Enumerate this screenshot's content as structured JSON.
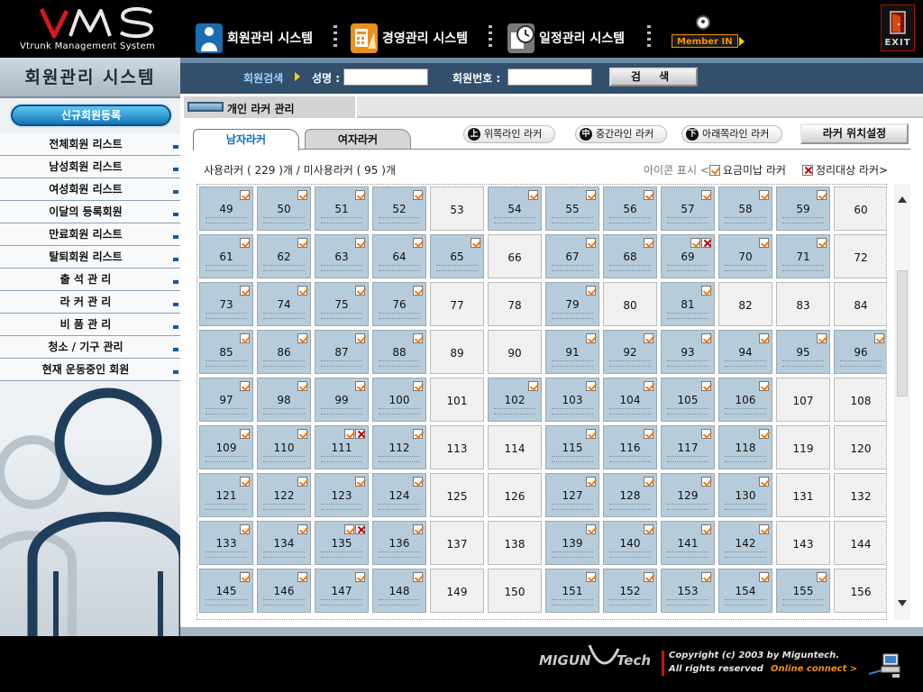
{
  "header": {
    "logo": "VMS",
    "logo_subtitle": "Vtrunk Management System",
    "nav": [
      {
        "label": "회원관리 시스템",
        "icon": "member-person-icon"
      },
      {
        "label": "경영관리 시스템",
        "icon": "calculator-chart-icon"
      },
      {
        "label": "일정관리 시스템",
        "icon": "clock-calendar-icon"
      }
    ],
    "member_in": "Member IN",
    "exit": "EXIT"
  },
  "sidebar": {
    "title": "회원관리 시스템",
    "new_member_button": "신규회원등록",
    "menu": [
      "전체회원 리스트",
      "남성회원 리스트",
      "여성회원 리스트",
      "이달의 등록회원",
      "만료회원 리스트",
      "탈퇴회원 리스트",
      "출 석 관 리",
      "라 커 관 리",
      "비 품 관 리",
      "청소 / 기구 관리",
      "현재 운동중인 회원"
    ]
  },
  "search": {
    "label": "회원검색",
    "name_label": "성명 :",
    "name_value": "",
    "member_no_label": "회원번호 :",
    "member_no_value": "",
    "button": "검 색"
  },
  "section": {
    "title": "개인 라커 관리"
  },
  "tabs": [
    "남자라커",
    "여자라커"
  ],
  "active_tab": 0,
  "line_buttons": [
    {
      "label": "위쪽라인 라커",
      "glyph": "上"
    },
    {
      "label": "중간라인 라커",
      "glyph": "中"
    },
    {
      "label": "아래쪽라인 라커",
      "glyph": "下"
    }
  ],
  "locker_position_button": "라커 위치설정",
  "usage": {
    "prefix": "사용라커 (",
    "used": "229",
    "middle": ")개 / 미사용라커 (",
    "unused": "95",
    "suffix": ")개"
  },
  "legend": {
    "caption": "아이콘 표시 <",
    "unpaid": "요금미납 라커",
    "cleanup": "정리대상 라커>"
  },
  "lockers": [
    {
      "n": "49",
      "s": "c"
    },
    {
      "n": "50",
      "s": "c"
    },
    {
      "n": "51",
      "s": "c"
    },
    {
      "n": "52",
      "s": "c"
    },
    {
      "n": "53",
      "s": "e"
    },
    {
      "n": "54",
      "s": "c"
    },
    {
      "n": "55",
      "s": "c"
    },
    {
      "n": "56",
      "s": "c"
    },
    {
      "n": "57",
      "s": "c"
    },
    {
      "n": "58",
      "s": "c"
    },
    {
      "n": "59",
      "s": "c"
    },
    {
      "n": "60",
      "s": "e"
    },
    {
      "n": "61",
      "s": "c"
    },
    {
      "n": "62",
      "s": "c"
    },
    {
      "n": "63",
      "s": "c"
    },
    {
      "n": "64",
      "s": "c"
    },
    {
      "n": "65",
      "s": "c"
    },
    {
      "n": "66",
      "s": "e"
    },
    {
      "n": "67",
      "s": "c"
    },
    {
      "n": "68",
      "s": "c"
    },
    {
      "n": "69",
      "s": "cx"
    },
    {
      "n": "70",
      "s": "c"
    },
    {
      "n": "71",
      "s": "c"
    },
    {
      "n": "72",
      "s": "e"
    },
    {
      "n": "73",
      "s": "c"
    },
    {
      "n": "74",
      "s": "c"
    },
    {
      "n": "75",
      "s": "c"
    },
    {
      "n": "76",
      "s": "c"
    },
    {
      "n": "77",
      "s": "e"
    },
    {
      "n": "78",
      "s": "e"
    },
    {
      "n": "79",
      "s": "c"
    },
    {
      "n": "80",
      "s": "e"
    },
    {
      "n": "81",
      "s": "c"
    },
    {
      "n": "82",
      "s": "e"
    },
    {
      "n": "83",
      "s": "e"
    },
    {
      "n": "84",
      "s": "e"
    },
    {
      "n": "85",
      "s": "c"
    },
    {
      "n": "86",
      "s": "c"
    },
    {
      "n": "87",
      "s": "c"
    },
    {
      "n": "88",
      "s": "c"
    },
    {
      "n": "89",
      "s": "e"
    },
    {
      "n": "90",
      "s": "e"
    },
    {
      "n": "91",
      "s": "c"
    },
    {
      "n": "92",
      "s": "c"
    },
    {
      "n": "93",
      "s": "c"
    },
    {
      "n": "94",
      "s": "c"
    },
    {
      "n": "95",
      "s": "c"
    },
    {
      "n": "96",
      "s": "c"
    },
    {
      "n": "97",
      "s": "c"
    },
    {
      "n": "98",
      "s": "c"
    },
    {
      "n": "99",
      "s": "c"
    },
    {
      "n": "100",
      "s": "c"
    },
    {
      "n": "101",
      "s": "e"
    },
    {
      "n": "102",
      "s": "c"
    },
    {
      "n": "103",
      "s": "c"
    },
    {
      "n": "104",
      "s": "c"
    },
    {
      "n": "105",
      "s": "c"
    },
    {
      "n": "106",
      "s": "c"
    },
    {
      "n": "107",
      "s": "e"
    },
    {
      "n": "108",
      "s": "e"
    },
    {
      "n": "109",
      "s": "c"
    },
    {
      "n": "110",
      "s": "c"
    },
    {
      "n": "111",
      "s": "cx"
    },
    {
      "n": "112",
      "s": "c"
    },
    {
      "n": "113",
      "s": "e"
    },
    {
      "n": "114",
      "s": "e"
    },
    {
      "n": "115",
      "s": "c"
    },
    {
      "n": "116",
      "s": "c"
    },
    {
      "n": "117",
      "s": "c"
    },
    {
      "n": "118",
      "s": "c"
    },
    {
      "n": "119",
      "s": "e"
    },
    {
      "n": "120",
      "s": "e"
    },
    {
      "n": "121",
      "s": "c"
    },
    {
      "n": "122",
      "s": "c"
    },
    {
      "n": "123",
      "s": "c"
    },
    {
      "n": "124",
      "s": "c"
    },
    {
      "n": "125",
      "s": "e"
    },
    {
      "n": "126",
      "s": "e"
    },
    {
      "n": "127",
      "s": "c"
    },
    {
      "n": "128",
      "s": "c"
    },
    {
      "n": "129",
      "s": "c"
    },
    {
      "n": "130",
      "s": "c"
    },
    {
      "n": "131",
      "s": "e"
    },
    {
      "n": "132",
      "s": "e"
    },
    {
      "n": "133",
      "s": "c"
    },
    {
      "n": "134",
      "s": "c"
    },
    {
      "n": "135",
      "s": "cx"
    },
    {
      "n": "136",
      "s": "c"
    },
    {
      "n": "137",
      "s": "e"
    },
    {
      "n": "138",
      "s": "e"
    },
    {
      "n": "139",
      "s": "c"
    },
    {
      "n": "140",
      "s": "c"
    },
    {
      "n": "141",
      "s": "c"
    },
    {
      "n": "142",
      "s": "c"
    },
    {
      "n": "143",
      "s": "e"
    },
    {
      "n": "144",
      "s": "e"
    },
    {
      "n": "145",
      "s": "c"
    },
    {
      "n": "146",
      "s": "c"
    },
    {
      "n": "147",
      "s": "c"
    },
    {
      "n": "148",
      "s": "c"
    },
    {
      "n": "149",
      "s": "e"
    },
    {
      "n": "150",
      "s": "e"
    },
    {
      "n": "151",
      "s": "c"
    },
    {
      "n": "152",
      "s": "c"
    },
    {
      "n": "153",
      "s": "c"
    },
    {
      "n": "154",
      "s": "c"
    },
    {
      "n": "155",
      "s": "c"
    },
    {
      "n": "156",
      "s": "e"
    }
  ],
  "footer": {
    "brand_a": "MIGUN",
    "brand_b": "Tech",
    "copyright": "Copyright (c) 2003 by Miguntech.",
    "rights": "All rights reserved",
    "online_connect": "Online connect >"
  },
  "colors": {
    "used_locker": "#b7ccda",
    "empty_locker": "#f0f0f0",
    "accent_orange": "#f29200",
    "search_bar": "#324f6c",
    "tab_active_text": "#0c6cc4"
  }
}
